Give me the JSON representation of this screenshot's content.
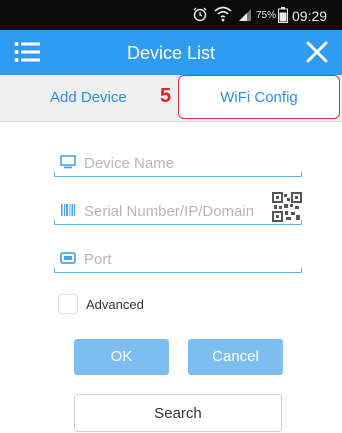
{
  "status_bar": {
    "battery": "75%",
    "time": "09:29",
    "icons": [
      "alarm-icon",
      "wifi-icon",
      "signal-icon",
      "battery-icon"
    ]
  },
  "header": {
    "title": "Device List",
    "menu_icon": "menu-icon",
    "close_icon": "close-icon"
  },
  "tabs": {
    "add_device": "Add Device",
    "step_number": "5",
    "wifi_config": "WiFi Config"
  },
  "form": {
    "device_name": {
      "placeholder": "Device Name",
      "value": "",
      "icon": "device-icon"
    },
    "serial": {
      "placeholder": "Serial Number/IP/Domain",
      "value": "",
      "icon": "barcode-icon",
      "qr_icon": "qr-code-icon"
    },
    "port": {
      "placeholder": "Port",
      "value": "",
      "icon": "port-icon"
    },
    "advanced_label": "Advanced"
  },
  "buttons": {
    "ok": "OK",
    "cancel": "Cancel",
    "search": "Search"
  },
  "colors": {
    "accent": "#2f9bf0",
    "button": "#7dbdf0",
    "step_red": "#e2202a"
  }
}
